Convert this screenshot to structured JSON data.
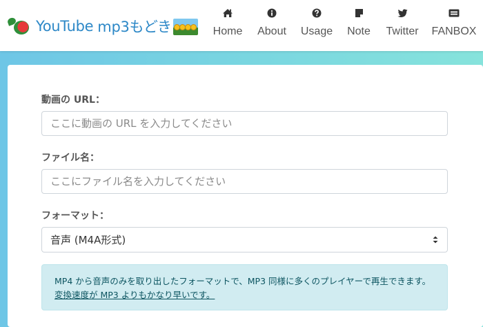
{
  "brand": {
    "name_part1": "YouTube",
    "name_part2": "mp3もどき"
  },
  "nav": {
    "items": [
      {
        "label": "Home",
        "icon": "home-icon"
      },
      {
        "label": "About",
        "icon": "info-icon"
      },
      {
        "label": "Usage",
        "icon": "question-icon"
      },
      {
        "label": "Note",
        "icon": "note-icon"
      },
      {
        "label": "Twitter",
        "icon": "twitter-icon"
      },
      {
        "label": "FANBOX",
        "icon": "fanbox-icon"
      }
    ]
  },
  "form": {
    "url_label": "動画の URL：",
    "url_placeholder": "ここに動画の URL を入力してください",
    "url_value": "",
    "filename_label": "ファイル名：",
    "filename_placeholder": "ここにファイル名を入力してください",
    "filename_value": "",
    "format_label": "フォーマット：",
    "format_selected": "音声 (M4A形式)"
  },
  "info": {
    "text": "MP4 から音声のみを取り出したフォーマットで、MP3 同様に多くのプレイヤーで再生できます。",
    "link_text": "変換速度が MP3 よりもかなり早いです。"
  },
  "colors": {
    "brand_blue": "#2d88c7",
    "background_gradient_start": "#6ec6e6",
    "background_gradient_end": "#86e3dc",
    "alert_background": "#d1ecf1",
    "alert_text": "#0c5460"
  }
}
